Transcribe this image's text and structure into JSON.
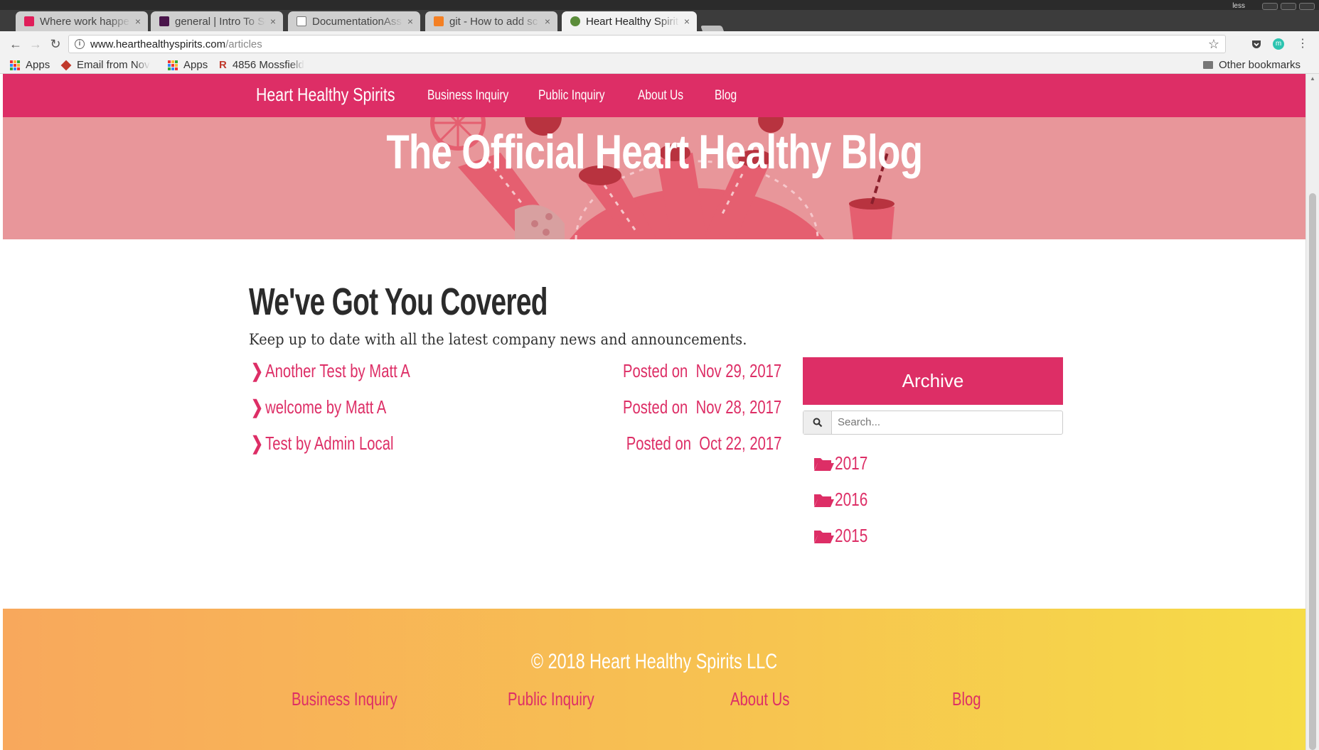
{
  "browser": {
    "tabs": [
      {
        "title": "Where work happe",
        "favicon_color": "#e01e5a"
      },
      {
        "title": "general | Intro To So",
        "favicon_color": "#4a154b"
      },
      {
        "title": "DocumentationAss",
        "favicon_color": "#ffffff"
      },
      {
        "title": "git - How to add sc",
        "favicon_color": "#f48024"
      },
      {
        "title": "Heart Healthy Spirit",
        "favicon_color": "#5b8c3a"
      }
    ],
    "close_glyph": "×",
    "window_label": "less",
    "url_host": "www.hearthealthyspirits.com",
    "url_path": "/articles",
    "bookmarks": [
      "Apps",
      "Email from Nov",
      "Apps",
      "4856 Mossfield",
      "Other bookmarks"
    ]
  },
  "site": {
    "brand": "Heart Healthy Spirits",
    "nav": [
      "Business Inquiry",
      "Public Inquiry",
      "About Us",
      "Blog"
    ],
    "hero_title": "The Official Heart Healthy Blog",
    "content_title": "We've Got You Covered",
    "subtitle": "Keep up to date with all the latest company news and announcements.",
    "posted_prefix": "Posted on",
    "articles": [
      {
        "title": "Another Test by Matt A",
        "date": "Nov 29, 2017"
      },
      {
        "title": "welcome by Matt A",
        "date": "Nov 28, 2017"
      },
      {
        "title": "Test by Admin Local",
        "date": "Oct 22, 2017"
      }
    ],
    "archive": {
      "title": "Archive",
      "search_placeholder": "Search...",
      "years": [
        "2017",
        "2016",
        "2015"
      ]
    },
    "footer": {
      "copyright": "© 2018 Heart Healthy Spirits LLC",
      "links": [
        "Business Inquiry",
        "Public Inquiry",
        "About Us",
        "Blog"
      ]
    },
    "colors": {
      "primary": "#dd2e66",
      "hero_bg": "#e8969a",
      "footer_start": "#f8a85c",
      "footer_end": "#f6dc47"
    }
  }
}
